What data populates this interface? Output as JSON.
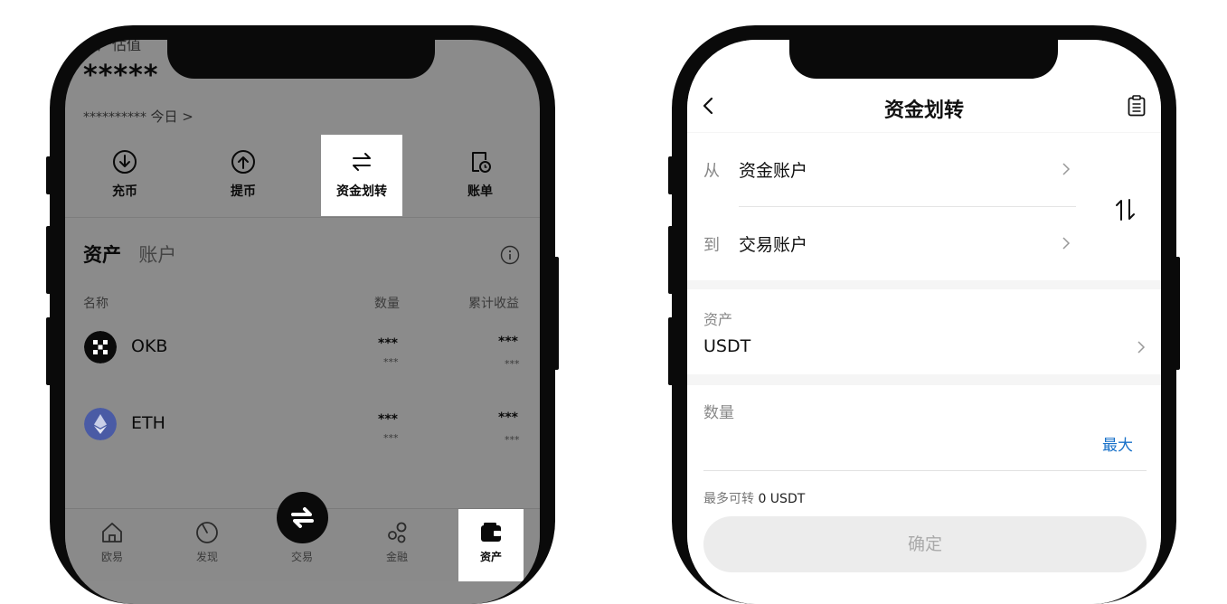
{
  "left_screen": {
    "header": {
      "title": "资产估值",
      "balance_mask": "*****",
      "daily_mask": "**********",
      "today_label": "今日 >"
    },
    "actions": [
      {
        "label": "充币",
        "icon": "deposit-icon"
      },
      {
        "label": "提币",
        "icon": "withdraw-icon"
      },
      {
        "label": "资金划转",
        "icon": "transfer-icon",
        "highlighted": true
      },
      {
        "label": "账单",
        "icon": "bill-icon"
      }
    ],
    "asset_tabs": {
      "assets": "资产",
      "accounts": "账户"
    },
    "columns": {
      "name": "名称",
      "amount": "数量",
      "profit": "累计收益"
    },
    "coins": [
      {
        "name": "OKB",
        "amount_mask": "***",
        "amount_sub_mask": "***",
        "profit_mask": "***",
        "profit_sub_mask": "***",
        "logo_color": "#0a0a0a"
      },
      {
        "name": "ETH",
        "amount_mask": "***",
        "amount_sub_mask": "***",
        "profit_mask": "***",
        "profit_sub_mask": "***",
        "logo_color": "#4a5ba5"
      }
    ],
    "tabbar": [
      {
        "label": "欧易",
        "icon": "home-icon"
      },
      {
        "label": "发现",
        "icon": "discover-icon"
      },
      {
        "label": "交易",
        "icon": "trade-icon"
      },
      {
        "label": "金融",
        "icon": "finance-icon"
      },
      {
        "label": "资产",
        "icon": "wallet-icon",
        "active": true
      }
    ],
    "overlay_color": "#8b8b8b"
  },
  "right_screen": {
    "header": {
      "title": "资金划转",
      "back_icon": "back-icon",
      "record_icon": "record-icon"
    },
    "transfer": {
      "from_label": "从",
      "from_value": "资金账户",
      "to_label": "到",
      "to_value": "交易账户"
    },
    "asset": {
      "label": "资产",
      "value": "USDT"
    },
    "amount": {
      "label": "数量",
      "max_label": "最大",
      "value": ""
    },
    "available": {
      "label": "最多可转",
      "value": "0 USDT"
    },
    "confirm_label": "确定",
    "accent_color": "#1a72c9"
  }
}
